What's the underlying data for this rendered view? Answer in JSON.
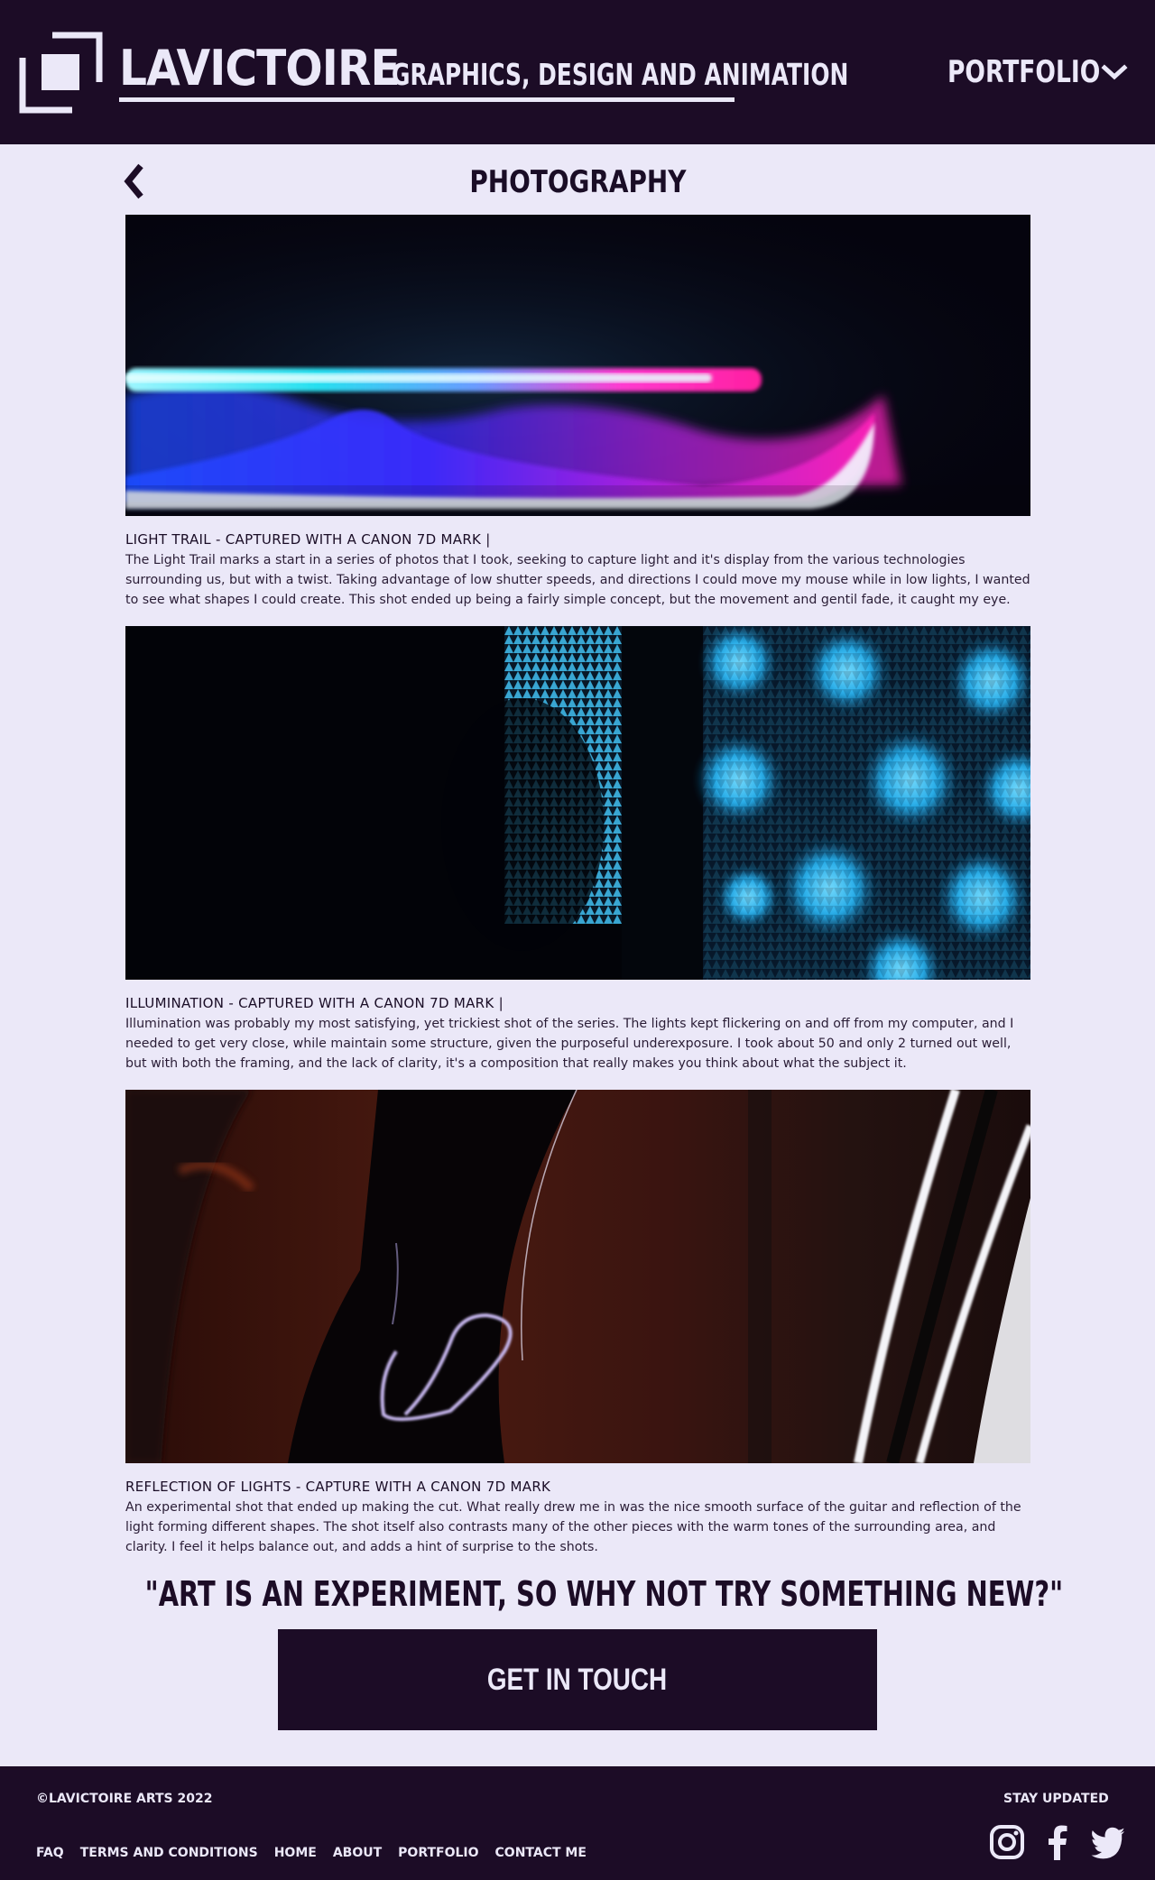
{
  "header": {
    "brand_name": "LAVICTOIRE",
    "tagline": "GRAPHICS, DESIGN AND ANIMATION",
    "nav_label": "PORTFOLIO"
  },
  "page": {
    "title": "PHOTOGRAPHY"
  },
  "photos": [
    {
      "caption_title": "LIGHT TRAIL - CAPTURED WITH A CANON 7D MARK |",
      "caption_body": "The Light Trail marks a start in a series of photos that I took, seeking to capture light and it's display from the various technologies surrounding us, but with a twist. Taking advantage of low shutter speeds, and directions I could move my mouse while in low lights, I wanted to see what shapes I could create. This shot ended up being a fairly simple concept, but the movement and gentil fade, it caught my eye."
    },
    {
      "caption_title": "ILLUMINATION - CAPTURED WITH A CANON 7D MARK |",
      "caption_body": "Illumination was probably my most satisfying, yet trickiest shot of the series. The lights kept flickering on and off from my computer, and I needed to get very close, while maintain some structure, given the purposeful underexposure. I took about 50 and only 2 turned out well, but with both the framing, and the lack of clarity, it's a composition that really makes you think about what the subject it."
    },
    {
      "caption_title": "REFLECTION OF LIGHTS - CAPTURE WITH A CANON 7D MARK",
      "caption_body": "An experimental shot that ended up making the cut. What really drew me in was the nice smooth surface of the guitar and reflection of the light forming different shapes. The shot itself also contrasts many of the other pieces with the warm tones of the surrounding area, and clarity. I feel it helps balance out, and adds a hint of surprise to the shots."
    }
  ],
  "quote": "\"ART IS AN EXPERIMENT, SO WHY NOT TRY SOMETHING NEW?\"",
  "cta": {
    "label": "GET IN TOUCH"
  },
  "footer": {
    "copyright": "©LAVICTOIRE ARTS 2022",
    "stay_updated": "STAY UPDATED",
    "links": [
      "FAQ",
      "TERMS AND CONDITIONS",
      "HOME",
      "ABOUT",
      "PORTFOLIO",
      "CONTACT ME"
    ],
    "socials": [
      "instagram-icon",
      "facebook-icon",
      "twitter-icon"
    ]
  },
  "colors": {
    "dark": "#1c0c26",
    "light": "#ebe8f8"
  }
}
